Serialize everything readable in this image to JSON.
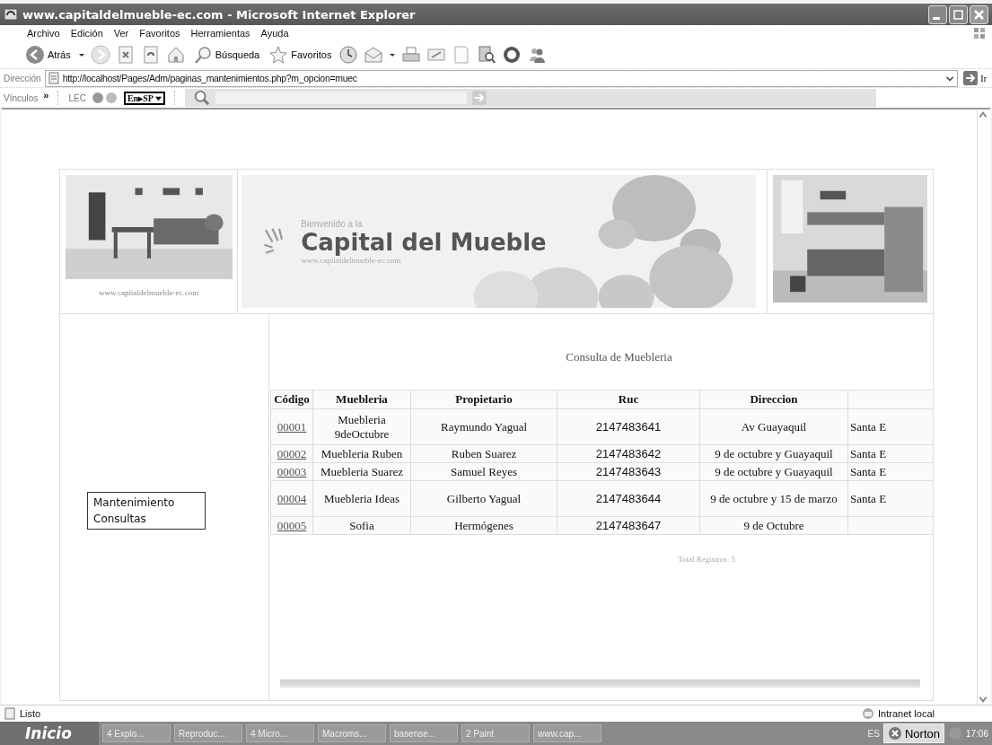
{
  "window": {
    "title": "www.capitaldelmueble-ec.com - Microsoft Internet Explorer"
  },
  "menu": [
    "Archivo",
    "Edición",
    "Ver",
    "Favoritos",
    "Herramientas",
    "Ayuda"
  ],
  "toolbar": {
    "back": "Atrás",
    "search": "Búsqueda",
    "favorites": "Favoritos"
  },
  "address": {
    "label": "Dirección",
    "url": "http://localhost/Pages/Adm/paginas_mantenimientos.php?m_opcion=muec",
    "go": "Ir"
  },
  "links_bar": {
    "label": "Vínculos",
    "chevron": "»",
    "item": "LEC",
    "translate": "En▸SP"
  },
  "page": {
    "site_url": "www.capitaldelmueble-ec.com",
    "banner": {
      "welcome": "Bienvenido a la",
      "title": "Capital del Mueble",
      "url": "www.capitaldelmueble-ec.com"
    },
    "side_menu": [
      {
        "label": "Mantenimiento"
      },
      {
        "label": "Consultas"
      }
    ],
    "heading": "Consulta de Muebleria",
    "table": {
      "columns": [
        "Código",
        "Muebleria",
        "Propietario",
        "Ruc",
        "Direccion"
      ],
      "rows": [
        {
          "codigo": "00001",
          "muebleria": "Muebleria 9deOctubre",
          "propietario": "Raymundo Yagual",
          "ruc": "2147483641",
          "direccion": "Av Guayaquil",
          "column_6": "Santa E"
        },
        {
          "codigo": "00002",
          "muebleria": "Muebleria Ruben",
          "propietario": "Ruben Suarez",
          "ruc": "2147483642",
          "direccion": "9 de octubre y Guayaquil",
          "column_6": "Santa E"
        },
        {
          "codigo": "00003",
          "muebleria": "Muebleria Suarez",
          "propietario": "Samuel Reyes",
          "ruc": "2147483643",
          "direccion": "9 de octubre y Guayaquil",
          "column_6": "Santa E"
        },
        {
          "codigo": "00004",
          "muebleria": "Muebleria Ideas",
          "propietario": "Gilberto Yagual",
          "ruc": "2147483644",
          "direccion": "9 de octubre y 15 de marzo",
          "column_6": "Santa E"
        },
        {
          "codigo": "00005",
          "muebleria": "Sofia",
          "propietario": "Hermógenes",
          "ruc": "2147483647",
          "direccion": "9 de Octubre"
        }
      ]
    },
    "total": "Total Registros: 5"
  },
  "status_bar": {
    "text": "Listo",
    "zone": "Intranet local"
  },
  "taskbar": {
    "start": "Inicio",
    "tasks": [
      "4 Explo...",
      "Reproduc...",
      "4 Micro...",
      "Macroms...",
      "basense...",
      "2 Paint",
      "www.cap..."
    ],
    "language": "ES",
    "norton": "Norton",
    "clock": "17:06"
  }
}
